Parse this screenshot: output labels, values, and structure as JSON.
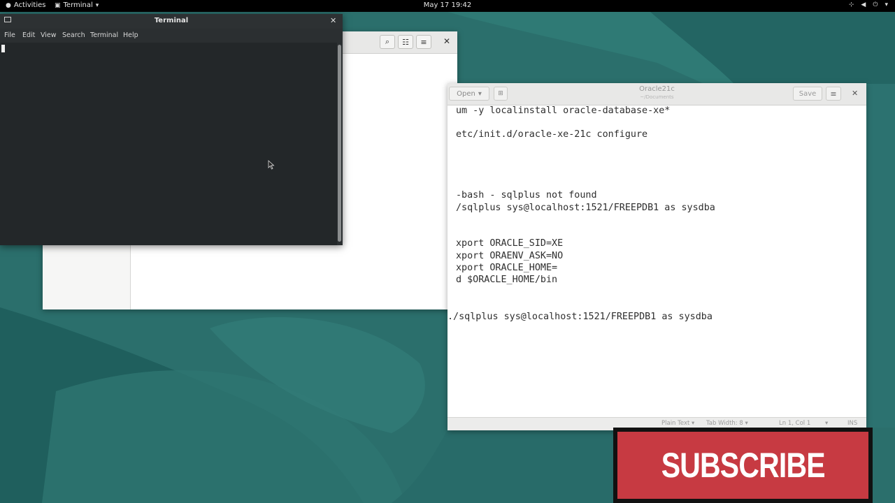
{
  "topbar": {
    "activities_label": "Activities",
    "app_menu_label": "Terminal",
    "clock": "May 17  19:42",
    "status_icons": [
      "network-icon",
      "volume-icon",
      "power-icon"
    ]
  },
  "terminal": {
    "title": "Terminal",
    "menu": [
      "File",
      "Edit",
      "View",
      "Search",
      "Terminal",
      "Help"
    ]
  },
  "gedit": {
    "open_label": "Open",
    "title": "Oracle21c",
    "subtitle": "~/Documents",
    "save_label": "Save",
    "lines": [
      "um -y localinstall oracle-database-xe*",
      "etc/init.d/oracle-xe-21c configure",
      "-bash - sqlplus not found",
      "/sqlplus sys@localhost:1521/FREEPDB1 as sysdba",
      "xport ORACLE_SID=XE",
      "xport ORAENV_ASK=NO",
      "xport ORACLE_HOME=",
      "d $ORACLE_HOME/bin",
      "./sqlplus sys@localhost:1521/FREEPDB1 as sysdba"
    ],
    "status": {
      "language": "Plain Text",
      "tab_width": "Tab Width: 8",
      "position": "Ln 1, Col 1",
      "mode": "INS"
    }
  },
  "overlay": {
    "subscribe_label": "SUBSCRIBE"
  },
  "colors": {
    "desktop": "#2a6e6b",
    "subscribe_bg": "#c73a42",
    "terminal_bg": "#232729"
  }
}
